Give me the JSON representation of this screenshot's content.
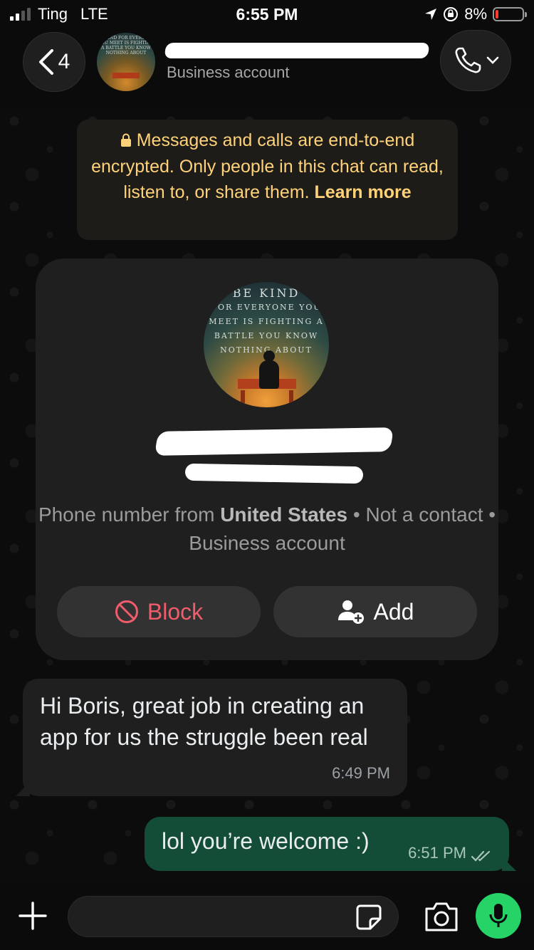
{
  "status_bar": {
    "carrier": "Ting",
    "network": "LTE",
    "time": "6:55 PM",
    "battery": "8%"
  },
  "header": {
    "back_count": "4",
    "subtitle": "Business account",
    "avatar_text": "BE KIND FOR EVERYONE YOU MEET IS FIGHTING A BATTLE YOU KNOW NOTHING ABOUT"
  },
  "encryption_banner": {
    "text": "Messages and calls are end-to-end encrypted. Only people in this chat can read, listen to, or share them.",
    "link": "Learn more"
  },
  "contact_card": {
    "avatar": {
      "line1": "BE KIND",
      "line2": "FOR EVERYONE YOU",
      "line3": "MEET IS FIGHTING A",
      "line4": "BATTLE YOU KNOW",
      "line5": "NOTHING ABOUT"
    },
    "info_prefix": "Phone number from",
    "country": "United States",
    "info_suffix": "• Not a contact • Business account",
    "block_label": "Block",
    "add_label": "Add"
  },
  "messages": [
    {
      "direction": "incoming",
      "text": "Hi Boris, great job in creating an app for us  the struggle been real",
      "time": "6:49 PM"
    },
    {
      "direction": "outgoing",
      "text": "lol you’re welcome :)",
      "time": "6:51 PM",
      "status": "read"
    }
  ],
  "input_bar": {
    "placeholder": ""
  },
  "colors": {
    "outgoing_bubble": "#144d37",
    "incoming_bubble": "#1f1f1f",
    "banner_text": "#ffd279",
    "block_red": "#f15c6d",
    "mic_green": "#25d366"
  }
}
